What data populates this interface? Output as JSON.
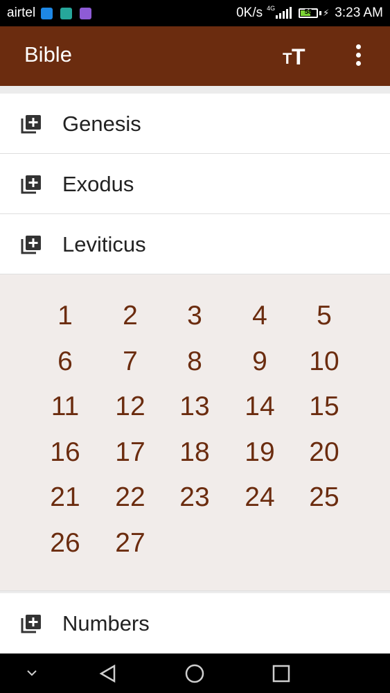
{
  "status_bar": {
    "carrier": "airtel",
    "speed": "0K/s",
    "network_type": "4G",
    "battery_level": "58",
    "time": "3:23 AM"
  },
  "app_bar": {
    "title": "Bible",
    "text_size_icon": "text-size-icon",
    "more_icon": "more-vert-icon"
  },
  "books": [
    {
      "name": "Genesis",
      "icon": "add-to-library-icon"
    },
    {
      "name": "Exodus",
      "icon": "add-to-library-icon"
    },
    {
      "name": "Leviticus",
      "icon": "add-to-library-icon"
    }
  ],
  "expanded_book": "Leviticus",
  "chapters": [
    "1",
    "2",
    "3",
    "4",
    "5",
    "6",
    "7",
    "8",
    "9",
    "10",
    "11",
    "12",
    "13",
    "14",
    "15",
    "16",
    "17",
    "18",
    "19",
    "20",
    "21",
    "22",
    "23",
    "24",
    "25",
    "26",
    "27"
  ],
  "after_books": [
    {
      "name": "Numbers",
      "icon": "add-to-library-icon"
    }
  ],
  "nav_bar": {
    "items": [
      "collapse-icon",
      "back-icon",
      "home-icon",
      "recents-icon"
    ]
  },
  "colors": {
    "primary": "#6b2c0f",
    "chapter_text": "#6b2c0f",
    "panel_bg": "#f1ecea"
  }
}
